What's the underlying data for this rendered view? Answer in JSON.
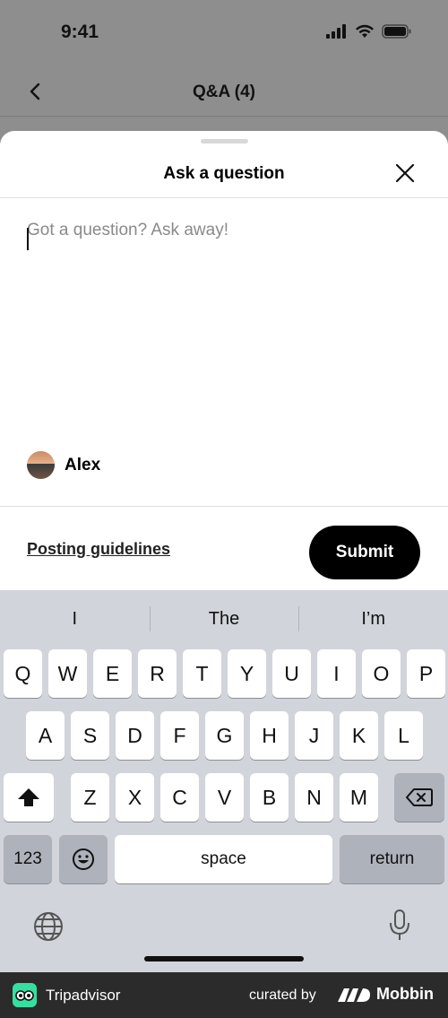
{
  "status_bar": {
    "time": "9:41"
  },
  "nav": {
    "title": "Q&A (4)"
  },
  "sheet": {
    "title": "Ask a question",
    "placeholder": "Got a question? Ask away!",
    "author": "Alex",
    "guidelines_label": "Posting guidelines",
    "submit_label": "Submit"
  },
  "keyboard": {
    "suggestions": [
      "I",
      "The",
      "I’m"
    ],
    "row1": [
      "Q",
      "W",
      "E",
      "R",
      "T",
      "Y",
      "U",
      "I",
      "O",
      "P"
    ],
    "row2": [
      "A",
      "S",
      "D",
      "F",
      "G",
      "H",
      "J",
      "K",
      "L"
    ],
    "row3": [
      "Z",
      "X",
      "C",
      "V",
      "B",
      "N",
      "M"
    ],
    "numbers_label": "123",
    "space_label": "space",
    "return_label": "return"
  },
  "footer": {
    "app_name": "Tripadvisor",
    "curated_label": "curated by",
    "brand": "Mobbin"
  },
  "colors": {
    "tripadvisor_green": "#34e0a1",
    "submit_bg": "#000000",
    "keyboard_bg": "#d1d4da"
  }
}
